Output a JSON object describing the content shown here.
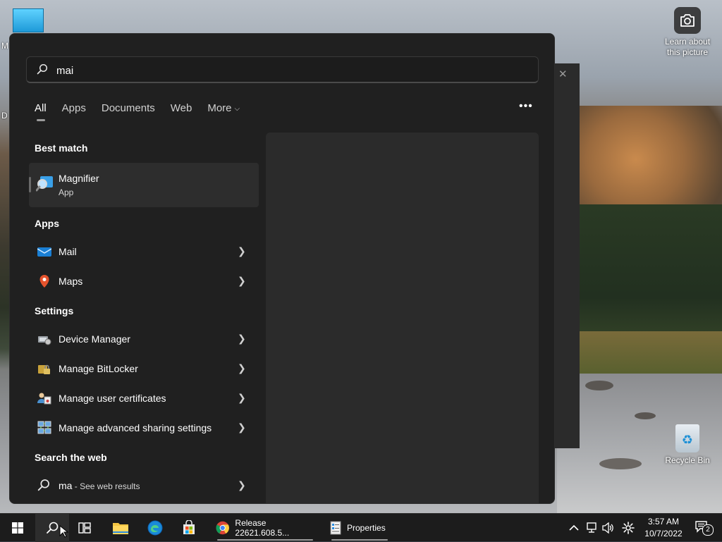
{
  "desktop": {
    "left_edge_letters": [
      "M",
      "D"
    ],
    "lens_widget": {
      "line1": "Learn about",
      "line2": "this picture"
    },
    "recycle_bin_label": "Recycle Bin",
    "background_window_close": "✕"
  },
  "search": {
    "query": "mai",
    "filters": [
      {
        "label": "All",
        "active": true
      },
      {
        "label": "Apps",
        "active": false
      },
      {
        "label": "Documents",
        "active": false
      },
      {
        "label": "Web",
        "active": false
      },
      {
        "label": "More",
        "active": false
      }
    ],
    "more_options_label": "•••",
    "sections": {
      "best_match": "Best match",
      "apps": "Apps",
      "settings": "Settings",
      "search_the_web": "Search the web"
    },
    "best_match": {
      "name": "Magnifier",
      "type": "App",
      "icon": "magnifier-icon"
    },
    "apps": [
      {
        "label": "Mail",
        "icon": "mail-icon"
      },
      {
        "label": "Maps",
        "icon": "maps-icon"
      }
    ],
    "settings": [
      {
        "label": "Device Manager",
        "icon": "device-manager-icon"
      },
      {
        "label": "Manage BitLocker",
        "icon": "bitlocker-icon"
      },
      {
        "label": "Manage user certificates",
        "icon": "certificates-icon"
      },
      {
        "label": "Manage advanced sharing settings",
        "icon": "sharing-settings-icon"
      }
    ],
    "web": {
      "term": "ma",
      "suffix": " - See web results",
      "icon": "search-icon"
    }
  },
  "taskbar": {
    "apps": [
      {
        "label": "Release 22621.608.5...",
        "icon": "chrome-icon"
      },
      {
        "label": "Properties",
        "icon": "properties-icon"
      }
    ],
    "clock": {
      "time": "3:57 AM",
      "date": "10/7/2022"
    },
    "notification_count": "2"
  },
  "colors": {
    "panel_bg": "#202020",
    "row_hover": "#2d2d2d",
    "taskbar_bg": "#1c1c1c",
    "accent_blue": "#0a84d6"
  }
}
